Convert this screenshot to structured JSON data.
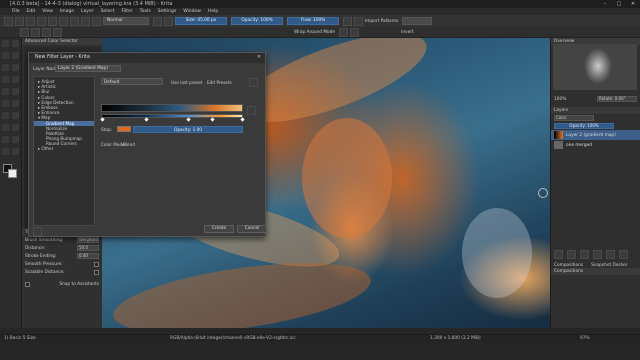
{
  "window": {
    "title": "[4.0.3 beta] - 14-4-3 (dialog) virtual_layering.kra (3.4 MiB) - Krita",
    "controls": [
      "–",
      "□",
      "✕"
    ]
  },
  "menu": [
    "File",
    "Edit",
    "View",
    "Image",
    "Layer",
    "Select",
    "Filter",
    "Tools",
    "Settings",
    "Window",
    "Help"
  ],
  "toolbar": {
    "blend_mode": "Normal",
    "size": "Size: 45.00 px",
    "opacity": "Opacity: 100%",
    "flow": "Flow: 100%",
    "wrap": "Wrap Around Mode",
    "pattern": "Import Patterns",
    "pattern_label": "Invert"
  },
  "left_dock": {
    "header": "Advanced Color Selector",
    "title2": "Brush Smoothing",
    "tool_options": "Tool Options",
    "rows": [
      {
        "label": "Brush Smoothing:",
        "value": "Weighted"
      },
      {
        "label": "Distance:",
        "value": "50.0"
      },
      {
        "label": "Stroke Ending:",
        "value": "0.40"
      },
      {
        "label": "Smooth Pressure:",
        "value": ""
      },
      {
        "label": "Scalable Distance:",
        "value": ""
      }
    ],
    "snap": "Snap to Assistants"
  },
  "right_dock": {
    "overview": "Overview",
    "zoom": "100%",
    "rotation": "Rotate: 0.00°",
    "layers_title": "Layers",
    "blend": "Color",
    "opacity": "Opacity: 100%",
    "layers": [
      {
        "name": "Layer 2 (gradient map)",
        "selected": true
      },
      {
        "name": "one merged",
        "selected": false
      }
    ],
    "tabs": [
      "Compositions",
      "Snapshot Docker"
    ],
    "compositions_title": "Compositions"
  },
  "status": {
    "left": "1) Basic-5 Size",
    "center": "RGB/Alpha (8-bit integer/channel)  sRGB-elle-V2-srgbtrc.icc",
    "right": "1,300 x 1,600 (3.2 MiB)",
    "zoom": "97%"
  },
  "dialog": {
    "title": "New Filter Layer - Krita",
    "close": "✕",
    "name_label": "Layer Name:",
    "name_value": "Layer 2 (Gradient Map)",
    "filters": [
      {
        "label": "▸ Adjust",
        "sub": false,
        "sel": false
      },
      {
        "label": "▸ Artistic",
        "sub": false,
        "sel": false
      },
      {
        "label": "▸ Blur",
        "sub": false,
        "sel": false
      },
      {
        "label": "▸ Colors",
        "sub": false,
        "sel": false
      },
      {
        "label": "▸ Edge Detection",
        "sub": false,
        "sel": false
      },
      {
        "label": "▸ Emboss",
        "sub": false,
        "sel": false
      },
      {
        "label": "▸ Enhance",
        "sub": false,
        "sel": false
      },
      {
        "label": "▾ Map",
        "sub": false,
        "sel": false
      },
      {
        "label": "Gradient Map",
        "sub": true,
        "sel": true
      },
      {
        "label": "Normalize",
        "sub": true,
        "sel": false
      },
      {
        "label": "Palettize",
        "sub": true,
        "sel": false
      },
      {
        "label": "Phong Bumpmap",
        "sub": true,
        "sel": false
      },
      {
        "label": "Round Corners",
        "sub": true,
        "sel": false
      },
      {
        "label": "▸ Other",
        "sub": false,
        "sel": false
      }
    ],
    "preset": "Default",
    "edit_presets": "Edit Presets",
    "use_last_preset": "Use last preset",
    "stops_label": "Stop:",
    "opacity_label": "Opacity: 1.00",
    "color_mode_label": "Color Mode:",
    "color_mode": "Blend",
    "ok": "Create",
    "cancel": "Cancel"
  }
}
